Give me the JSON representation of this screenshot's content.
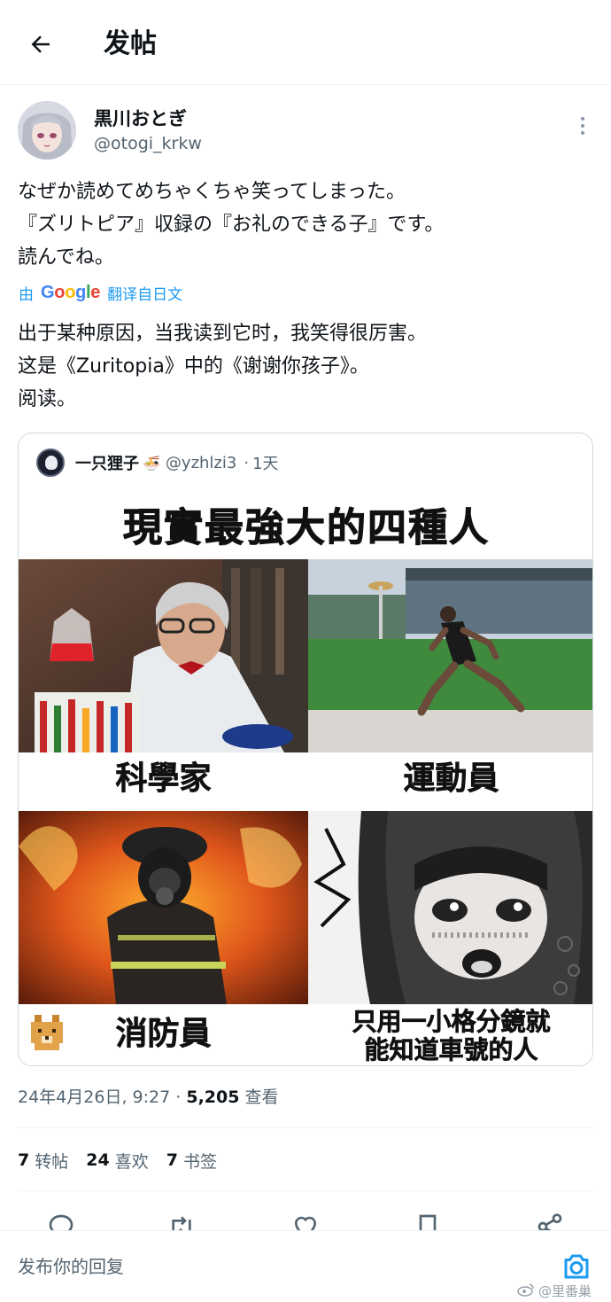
{
  "header": {
    "title": "发帖"
  },
  "author": {
    "name": "黒川おとぎ",
    "handle": "@otogi_krkw"
  },
  "tweet": {
    "lines": [
      "なぜか読めてめちゃくちゃ笑ってしまった。",
      "『ズリトピア』収録の『お礼のできる子』です。",
      "読んでね。"
    ]
  },
  "translation": {
    "prefix": "由",
    "provider": "Google",
    "suffix": "翻译自日文",
    "lines": [
      "出于某种原因，当我读到它时，我笑得很厉害。",
      "这是《Zuritopia》中的《谢谢你孩子》。",
      "阅读。"
    ]
  },
  "quote": {
    "name": "一只狸子",
    "handle": "@yzhlzi3",
    "separator": "·",
    "time": "1天",
    "meme": {
      "title": "現實最強大的四種人",
      "captions": [
        "科學家",
        "運動員",
        "消防員",
        "只用一小格分鏡就",
        "能知道車號的人"
      ]
    }
  },
  "meta": {
    "date": "24年4月26日, 9:27",
    "separator": "·",
    "views": "5,205",
    "views_label": "查看"
  },
  "stats": [
    {
      "count": "7",
      "label": "转帖"
    },
    {
      "count": "24",
      "label": "喜欢"
    },
    {
      "count": "7",
      "label": "书签"
    }
  ],
  "actions": [
    "reply-icon",
    "retweet-icon",
    "like-icon",
    "bookmark-icon",
    "share-icon"
  ],
  "reply": {
    "placeholder": "发布你的回复"
  },
  "watermark": {
    "text": "@里番巢"
  },
  "colors": {
    "link": "#1d9bf0",
    "secondary": "#536471",
    "text": "#0f1419",
    "border": "#cfd9de"
  }
}
